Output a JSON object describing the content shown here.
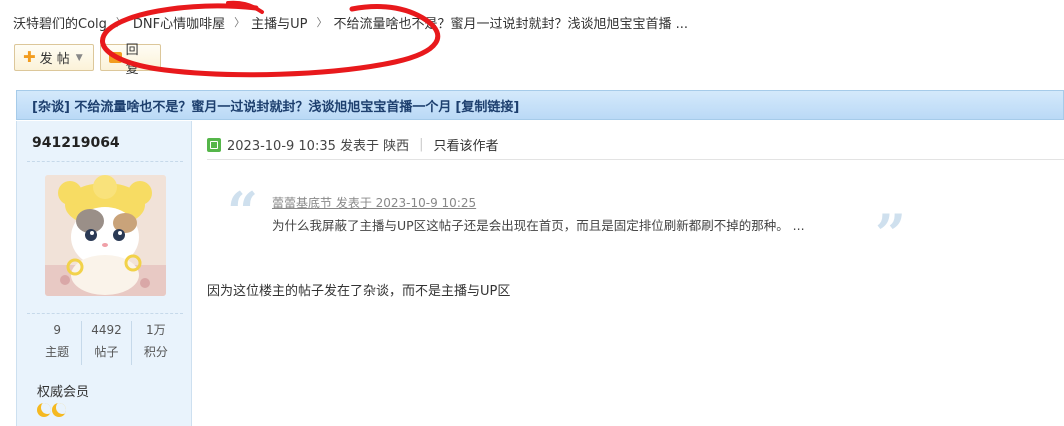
{
  "breadcrumb": {
    "items": [
      "沃特碧们的Colg",
      "DNF心情咖啡屋",
      "主播与UP"
    ],
    "current": "不给流量啥也不是？蜜月一过说封就封？浅谈旭旭宝宝首播 ..."
  },
  "toolbar": {
    "post_label": "发 帖",
    "reply_label": "回复"
  },
  "thread": {
    "title": "[杂谈] 不给流量啥也不是？蜜月一过说封就封？浅谈旭旭宝宝首播一个月",
    "copy_link": "[复制链接]"
  },
  "author": {
    "username": "941219064",
    "stats": [
      {
        "value": "9",
        "label": "主题"
      },
      {
        "value": "4492",
        "label": "帖子"
      },
      {
        "value": "1万",
        "label": "积分"
      }
    ],
    "group": "权威会员"
  },
  "post": {
    "meta": "2023-10-9 10:35 发表于 陕西",
    "only_author": "只看该作者",
    "quote_author": "蕾蕾基底节 发表于 2023-10-9 10:25",
    "quote_text": "为什么我屏蔽了主播与UP区这帖子还是会出现在首页，而且是固定排位刷新都刷不掉的那种。 ...",
    "body": "因为这位楼主的帖子发在了杂谈，而不是主播与UP区"
  },
  "colors": {
    "titlebar_bg": "#c8e1f8",
    "sidebar_bg": "#e9f3fc",
    "annotation": "#e8191c"
  }
}
